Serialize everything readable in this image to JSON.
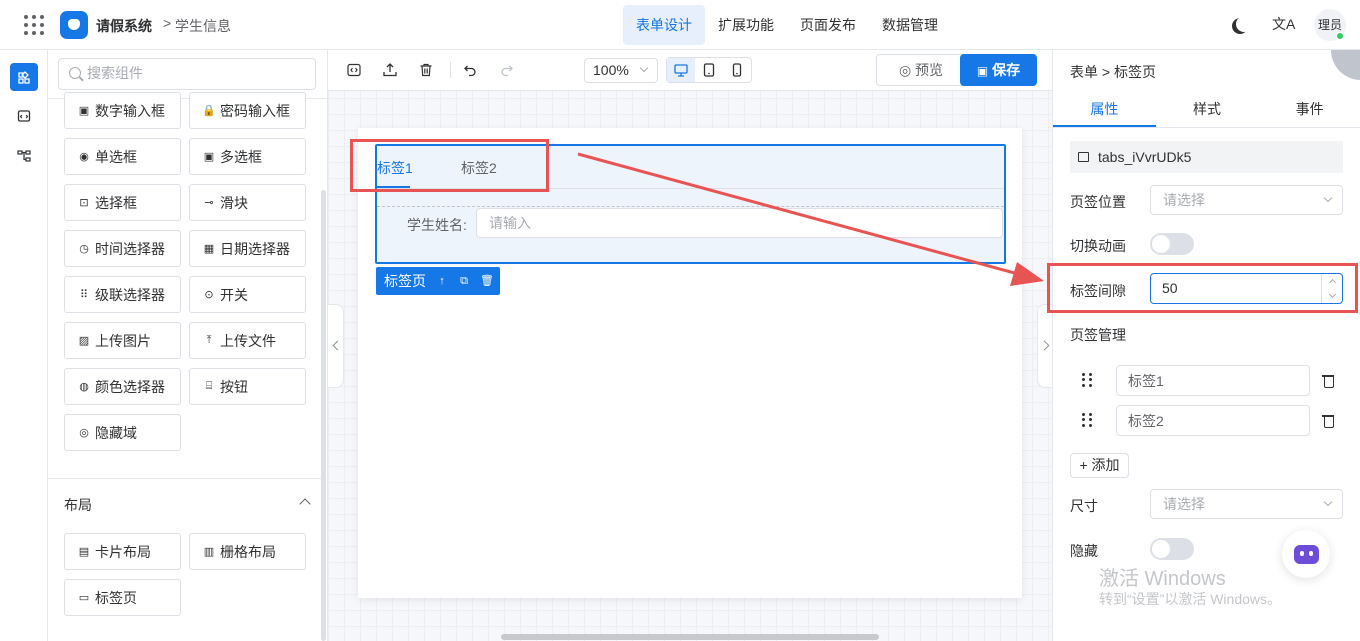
{
  "header": {
    "app_name": "请假系统",
    "breadcrumb_sep": ">",
    "breadcrumb": "学生信息",
    "nav": [
      "表单设计",
      "扩展功能",
      "页面发布",
      "数据管理"
    ],
    "active_nav": "表单设计",
    "translate_icon": "文A",
    "avatar_text": "理员"
  },
  "component_panel": {
    "search_placeholder": "搜索组件",
    "components": [
      {
        "label": "数字输入框",
        "icon": "number-input-icon",
        "glyph": "▣"
      },
      {
        "label": "密码输入框",
        "icon": "lock-icon",
        "glyph": "🔒"
      },
      {
        "label": "单选框",
        "icon": "radio-icon",
        "glyph": "◉"
      },
      {
        "label": "多选框",
        "icon": "checkbox-icon",
        "glyph": "▣"
      },
      {
        "label": "选择框",
        "icon": "select-icon",
        "glyph": "⊡"
      },
      {
        "label": "滑块",
        "icon": "slider-icon",
        "glyph": "⊸"
      },
      {
        "label": "时间选择器",
        "icon": "clock-icon",
        "glyph": "◷"
      },
      {
        "label": "日期选择器",
        "icon": "calendar-icon",
        "glyph": "▦"
      },
      {
        "label": "级联选择器",
        "icon": "cascader-icon",
        "glyph": "⠿"
      },
      {
        "label": "开关",
        "icon": "switch-icon",
        "glyph": "⊙"
      },
      {
        "label": "上传图片",
        "icon": "image-icon",
        "glyph": "▨"
      },
      {
        "label": "上传文件",
        "icon": "upload-icon",
        "glyph": "⤒"
      },
      {
        "label": "颜色选择器",
        "icon": "palette-icon",
        "glyph": "◍"
      },
      {
        "label": "按钮",
        "icon": "button-icon",
        "glyph": "⌸"
      },
      {
        "label": "隐藏域",
        "icon": "eye-off-icon",
        "glyph": "◎"
      }
    ],
    "layout_section": {
      "title": "布局",
      "items": [
        {
          "label": "卡片布局",
          "icon": "card-icon",
          "glyph": "▤"
        },
        {
          "label": "栅格布局",
          "icon": "grid-layout-icon",
          "glyph": "▥"
        },
        {
          "label": "标签页",
          "icon": "tabs-icon",
          "glyph": "▭"
        }
      ]
    }
  },
  "toolbar": {
    "zoom": "100%",
    "preview_label": "预览",
    "save_label": "保存",
    "preview_icon": "◎",
    "save_icon": "▣"
  },
  "canvas": {
    "tabs": [
      "标签1",
      "标签2"
    ],
    "field_label": "学生姓名:",
    "field_placeholder": "请输入",
    "selected_tag": "标签页",
    "tag_icons": [
      "↑",
      "⧉",
      "🗑"
    ]
  },
  "properties": {
    "breadcrumb": "表单 > 标签页",
    "tabs": [
      "属性",
      "样式",
      "事件"
    ],
    "active_tab": "属性",
    "component_id": "tabs_iVvrUDk5",
    "tab_position_label": "页签位置",
    "tab_position_placeholder": "请选择",
    "switch_animation_label": "切换动画",
    "tab_gap_label": "标签间隙",
    "tab_gap_value": "50",
    "tab_manage_label": "页签管理",
    "tab_items": [
      "标签1",
      "标签2"
    ],
    "add_label": "+ 添加",
    "size_label": "尺寸",
    "size_placeholder": "请选择",
    "hidden_label": "隐藏"
  },
  "watermark": {
    "line1": "激活 Windows",
    "line2": "转到“设置”以激活 Windows。"
  },
  "colors": {
    "primary": "#1677e6",
    "annotation": "#e85454"
  }
}
